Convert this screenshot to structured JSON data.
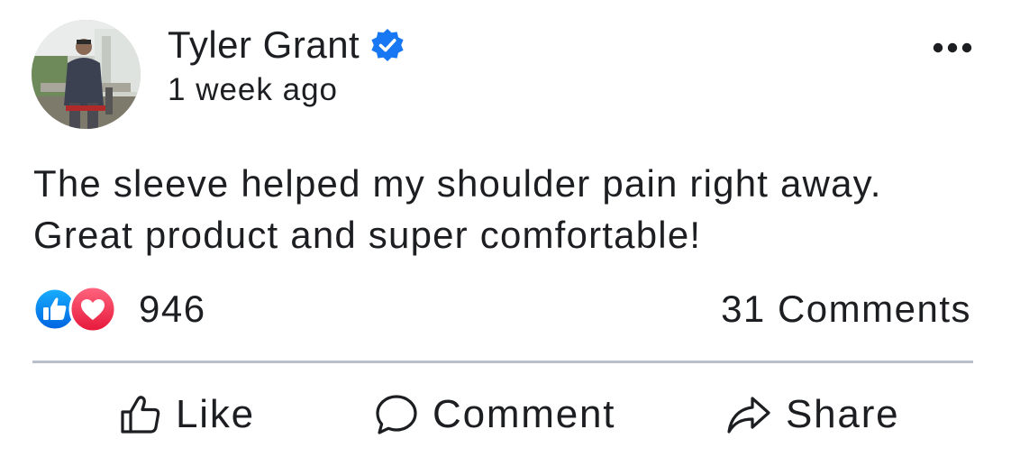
{
  "author": {
    "name": "Tyler Grant",
    "verified": true,
    "timestamp": "1 week ago",
    "avatar": "avatar-photo-man-outdoors"
  },
  "menu": {
    "icon": "more-options-icon"
  },
  "post": {
    "text": "The sleeve helped my shoulder pain right away. Great product and super comfortable!"
  },
  "reactions": {
    "types": [
      "like-reaction-icon",
      "love-reaction-icon"
    ],
    "count": "946",
    "comments": "31 Comments"
  },
  "actions": {
    "like": {
      "label": "Like",
      "icon": "thumbs-up-icon"
    },
    "comment": {
      "label": "Comment",
      "icon": "speech-bubble-icon"
    },
    "share": {
      "label": "Share",
      "icon": "share-arrow-icon"
    }
  },
  "colors": {
    "verified_blue": "#1877f2",
    "like_blue": "#1877f2",
    "love_red": "#f33e58",
    "divider": "#b9c0cb",
    "text": "#1c1e21"
  }
}
